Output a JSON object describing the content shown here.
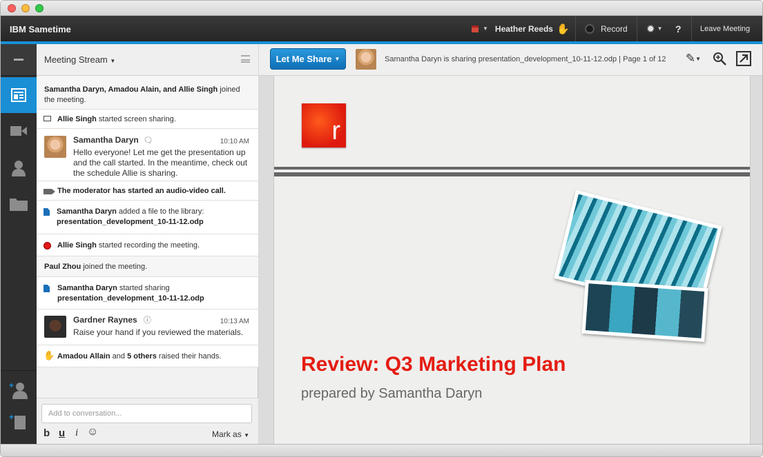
{
  "app": {
    "title": "IBM Sametime",
    "user_name": "Heather Reeds",
    "record_label": "Record",
    "help_label": "?",
    "leave_label": "Leave Meeting"
  },
  "rail": {
    "items": [
      {
        "name": "meeting-stream",
        "icon": "stream-icon",
        "active": true
      },
      {
        "name": "video",
        "icon": "video-camera-icon",
        "active": false
      },
      {
        "name": "participants",
        "icon": "person-icon",
        "active": false
      },
      {
        "name": "library",
        "icon": "folder-icon",
        "active": false
      }
    ],
    "bottom": [
      {
        "name": "invite-person",
        "icon": "add-person-icon"
      },
      {
        "name": "add-file",
        "icon": "add-file-icon"
      }
    ]
  },
  "stream": {
    "title": "Meeting Stream",
    "events": [
      {
        "type": "system",
        "text_bold": "Samantha Daryn, Amadou Alain, and Allie Singh",
        "text": " joined the meeting."
      },
      {
        "type": "system",
        "icon": "screen-share-icon",
        "text_bold": "Allie Singh",
        "text": " started screen sharing."
      },
      {
        "type": "chat",
        "name": "Samantha Daryn",
        "time": "10:10 AM",
        "text": "Hello everyone! Let me get the presentation up and the call started. In the meantime, check out the schedule Allie is sharing."
      },
      {
        "type": "system",
        "icon": "video-camera-icon",
        "text_bold": "The moderator has started an audio-video call.",
        "text": ""
      },
      {
        "type": "file",
        "icon": "document-icon",
        "text_bold": "Samantha Daryn",
        "text": " added a file to the library:",
        "file": "presentation_development_10-11-12.odp"
      },
      {
        "type": "system",
        "icon": "record-icon",
        "text_bold": "Allie Singh",
        "text": " started recording the meeting."
      },
      {
        "type": "system",
        "text_bold": "Paul Zhou",
        "text": " joined the meeting."
      },
      {
        "type": "file",
        "icon": "document-icon",
        "text_bold": "Samantha Daryn",
        "text": " started sharing",
        "file": "presentation_development_10-11-12.odp"
      },
      {
        "type": "chat",
        "name": "Gardner Raynes",
        "time": "10:13 AM",
        "text": "Raise your hand if you reviewed the materials."
      },
      {
        "type": "system",
        "icon": "raised-hand-icon",
        "text_bold": "Amadou Allain",
        "text_mid": " and ",
        "text_bold2": "5 others",
        "text": " raised their hands."
      }
    ],
    "composer": {
      "placeholder": "Add to conversation...",
      "bold": "b",
      "underline": "u",
      "italic": "i",
      "emoji": "☺",
      "mark_as": "Mark as"
    }
  },
  "share": {
    "button_label": "Let Me Share",
    "status_text": "Samantha Daryn is sharing presentation_development_10-11-12.odp | Page 1 of 12"
  },
  "slide": {
    "logo_letter": "r",
    "title": "Review: Q3 Marketing Plan",
    "subtitle": "prepared by Samantha Daryn"
  },
  "colors": {
    "accent": "#1a8fd6",
    "title_red": "#e41c13",
    "record_red": "#e01818"
  }
}
